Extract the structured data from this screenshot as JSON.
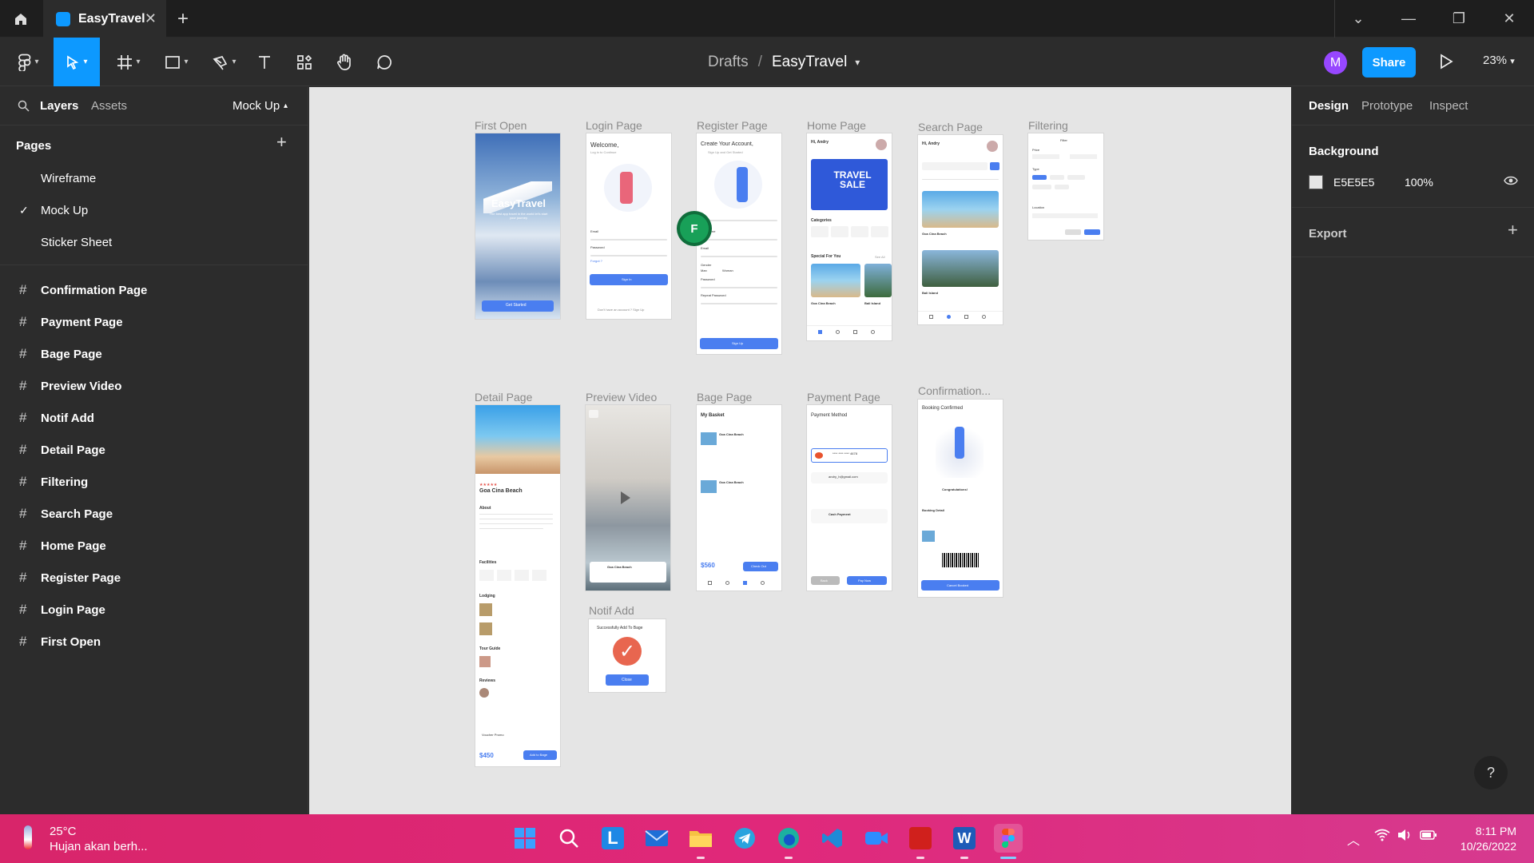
{
  "tab": {
    "title": "EasyTravel"
  },
  "breadcrumb": {
    "parent": "Drafts",
    "separator": "/",
    "current": "EasyTravel"
  },
  "header": {
    "avatar_initial": "M",
    "share_label": "Share",
    "zoom": "23%"
  },
  "left_panel": {
    "tabs": {
      "layers": "Layers",
      "assets": "Assets",
      "page_selector": "Mock Up"
    },
    "pages_title": "Pages",
    "pages": [
      {
        "label": "Wireframe",
        "selected": false
      },
      {
        "label": "Mock Up",
        "selected": true
      },
      {
        "label": "Sticker Sheet",
        "selected": false
      }
    ],
    "frames": [
      "Confirmation Page",
      "Payment Page",
      "Bage Page",
      "Preview Video",
      "Notif Add",
      "Detail Page",
      "Filtering",
      "Search Page",
      "Home Page",
      "Register Page",
      "Login Page",
      "First Open"
    ]
  },
  "right_panel": {
    "tabs": {
      "design": "Design",
      "prototype": "Prototype",
      "inspect": "Inspect"
    },
    "background_title": "Background",
    "background_hex": "E5E5E5",
    "background_opacity": "100%",
    "export_title": "Export"
  },
  "canvas": {
    "cursor_initial": "F",
    "frames": {
      "first_open": {
        "label": "First Open",
        "title": "EasyTravel",
        "subtitle": "The best app travel in the world let's start your journey",
        "button": "Get Started"
      },
      "login": {
        "label": "Login Page",
        "welcome": "Welcome,",
        "sub": "Log in to Continue",
        "email": "Email",
        "password": "Password",
        "forgot": "Forgot ?",
        "button": "Sign In",
        "footer": "Don't have an account ? Sign Up"
      },
      "register": {
        "label": "Register Page",
        "title": "Create Your Account,",
        "sub": "Sign Up and Get Started",
        "username": "Username",
        "email": "Email",
        "gender": "Gender",
        "man": "Man",
        "woman": "Woman",
        "password": "Password",
        "repeat": "Repeat Password",
        "button": "Sign Up"
      },
      "home": {
        "label": "Home Page",
        "greeting": "Hi, Andry",
        "banner": "TRAVEL SALE",
        "categories": "Categories",
        "special": "Special For You",
        "see_all": "See All",
        "place1": "Goa Cina Beach",
        "place2": "Bali Island"
      },
      "search": {
        "label": "Search Page",
        "greeting": "Hi, Andry",
        "place1": "Goa Cina Beach",
        "place2": "Bali Island"
      },
      "filtering": {
        "label": "Filtering",
        "title": "Filter",
        "price": "Price",
        "type": "Type",
        "location": "Location"
      },
      "detail": {
        "label": "Detail Page",
        "title": "Goa Cina Beach",
        "about": "About",
        "facilities": "Facilities",
        "lodging": "Lodging",
        "tour_guide": "Tour Guide",
        "reviews": "Reviews",
        "voucher": "Voucher Promo",
        "price": "$450",
        "button": "Add to Bage"
      },
      "preview": {
        "label": "Preview Video",
        "card": "Goa Cina Beach"
      },
      "bage": {
        "label": "Bage Page",
        "title": "My Basket",
        "item": "Goa Cina Beach",
        "total": "$560",
        "button": "Check Out"
      },
      "payment": {
        "label": "Payment Page",
        "title": "Payment Method",
        "card": "**** **** **** 4678",
        "email": "andry_h@gmail.com",
        "cash": "Cash Payment",
        "back": "Back",
        "pay": "Pay Now"
      },
      "confirmation": {
        "label": "Confirmation...",
        "title": "Booking Confirmed",
        "congrats": "Congratulations!",
        "detail": "Booking Detail",
        "button": "Cancel Booked"
      },
      "notif": {
        "label": "Notif Add",
        "message": "Successfully Add To Bage",
        "button": "Close"
      }
    }
  },
  "taskbar": {
    "temperature": "25°C",
    "weather": "Hujan akan berh...",
    "time": "8:11 PM",
    "date": "10/26/2022"
  },
  "colors": {
    "accent": "#0d99ff",
    "frame_button": "#4a7ef0",
    "canvas_bg": "#E5E5E5"
  }
}
